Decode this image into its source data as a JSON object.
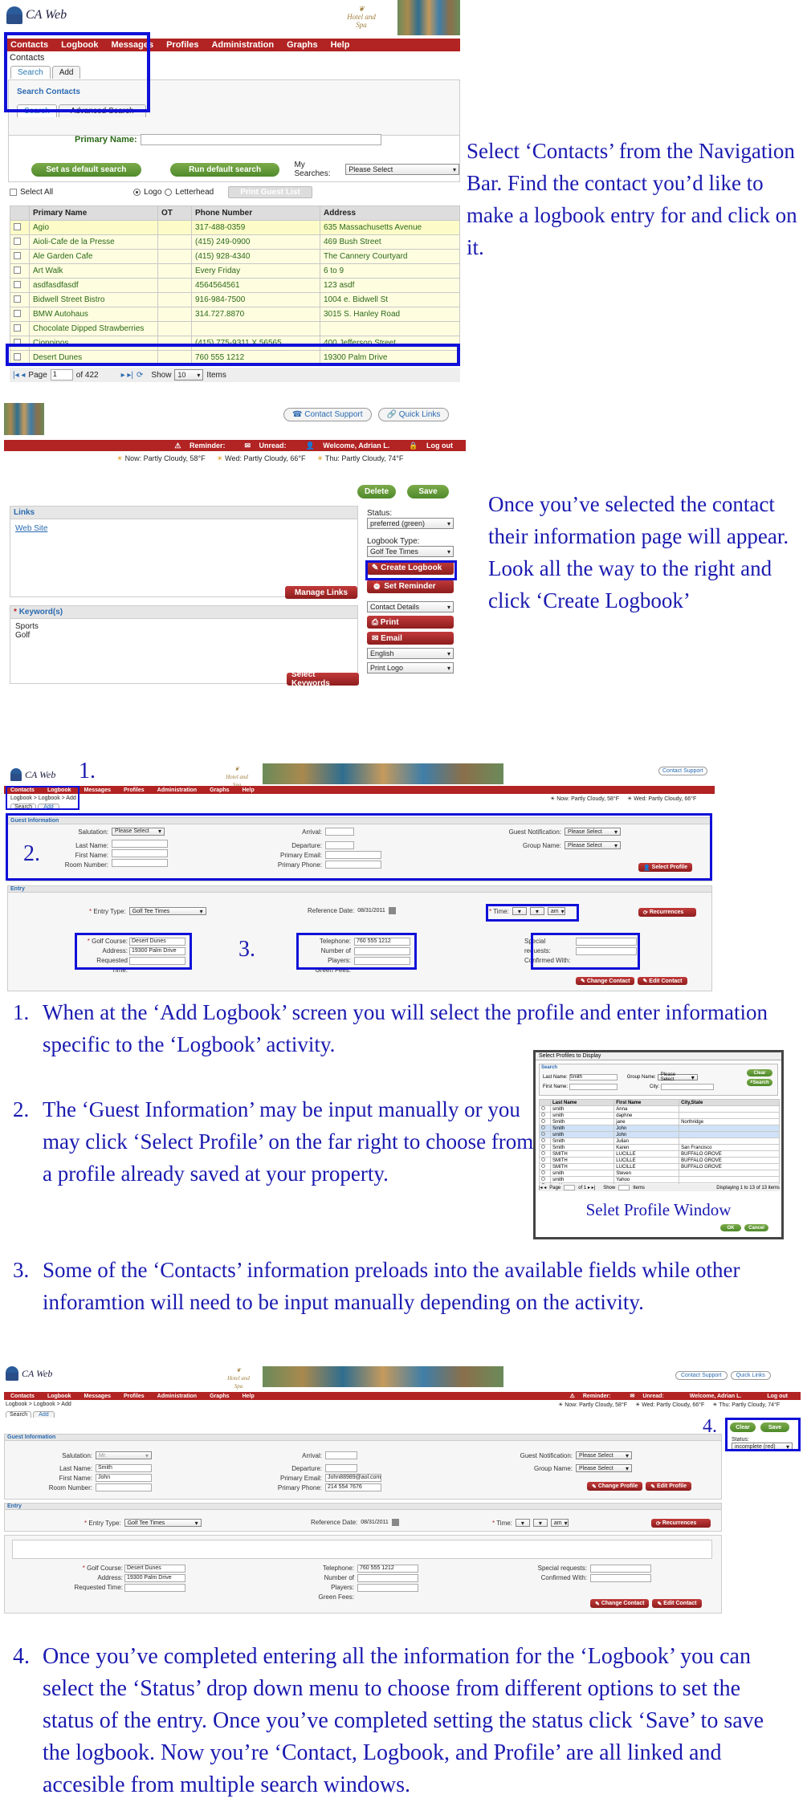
{
  "shot1": {
    "app_name": "CA Web",
    "hotel_logo_lines": [
      "Hotel and Spa"
    ],
    "nav": [
      "Contacts",
      "Logbook",
      "Messages",
      "Profiles",
      "Administration",
      "Graphs",
      "Help"
    ],
    "page_title": "Contacts",
    "tabs": [
      "Search",
      "Add"
    ],
    "section": "Search Contacts",
    "subtabs": [
      "Search",
      "Advanced Search"
    ],
    "primary_name_label": "Primary Name:",
    "set_default": "Set as default search",
    "run_default": "Run default search",
    "my_searches_label": "My Searches:",
    "my_searches_value": "Please Select",
    "select_all": "Select All",
    "logo_opt": "Logo",
    "letterhead_opt": "Letterhead",
    "print_guest_list": "Print Guest List",
    "columns": [
      "Primary Name",
      "OT",
      "Phone Number",
      "Address"
    ],
    "rows": [
      [
        "Agio",
        "",
        "317-488-0359",
        "635 Massachusetts Avenue"
      ],
      [
        "Aioli-Cafe de la Presse",
        "",
        "(415) 249-0900",
        "469 Bush Street"
      ],
      [
        "Ale Garden Cafe",
        "",
        "(415) 928-4340",
        "The Cannery Courtyard"
      ],
      [
        "Art Walk",
        "",
        "Every Friday",
        "6 to 9"
      ],
      [
        "asdfasdfasdf",
        "",
        "4564564561",
        "123 asdf"
      ],
      [
        "Bidwell Street Bistro",
        "",
        "916-984-7500",
        "1004 e. Bidwell St"
      ],
      [
        "BMW Autohaus",
        "",
        "314.727.8870",
        "3015 S. Hanley Road"
      ],
      [
        "Chocolate Dipped Strawberries",
        "",
        "",
        ""
      ],
      [
        "Cioppinos",
        "",
        "(415) 775-9311 X 56565",
        "400 Jefferson Street"
      ],
      [
        "Desert Dunes",
        "",
        "760 555 1212",
        "19300 Palm Drive"
      ]
    ],
    "pager_page": "Page",
    "pager_value": "1",
    "pager_of": "of 422",
    "pager_show": "Show",
    "pager_show_value": "10",
    "pager_items": "Items"
  },
  "instruction1": "Select ‘Contacts’ from the Navigation Bar.  Find the contact you’d like to make a logbook entry for and click on it.",
  "shot2": {
    "contact_support": "Contact Support",
    "quick_links": "Quick Links",
    "reminder": "Reminder:",
    "unread": "Unread:",
    "welcome": "Welcome, Adrian L.",
    "logout": "Log out",
    "weather_now": "Now: Partly Cloudy, 58°F",
    "weather_wed": "Wed: Partly Cloudy, 66°F",
    "weather_thu": "Thu: Partly Cloudy, 74°F",
    "delete": "Delete",
    "save": "Save",
    "links_hdr": "Links",
    "web_site": "Web Site",
    "manage_links": "Manage Links",
    "keywords_hdr": "Keyword(s)",
    "keywords": [
      "Sports",
      "Golf"
    ],
    "select_keywords": "Select Keywords",
    "status_label": "Status:",
    "status_value": "preferred (green)",
    "logbook_type_label": "Logbook Type:",
    "logbook_type_value": "Golf Tee Times",
    "create_logbook": "Create Logbook",
    "set_reminder": "Set Reminder",
    "contact_details": "Contact Details",
    "print": "Print",
    "email": "Email",
    "language": "English",
    "print_logo": "Print Logo"
  },
  "instruction2": "Once you’ve selected the contact their information page will appear.  Look all the way to the right and click ‘Create Logbook’",
  "shot3": {
    "marker1": "1.",
    "marker2": "2.",
    "marker3": "3.",
    "breadcrumb": "Logbook > Logbook > Add",
    "contact_support": "Contact Support",
    "guest_info_hdr": "Guest Information",
    "salutation": "Salutation:",
    "please_select": "Please Select",
    "last_name": "Last Name:",
    "first_name": "First Name:",
    "room_number": "Room Number:",
    "arrival": "Arrival:",
    "departure": "Departure:",
    "primary_email": "Primary Email:",
    "primary_phone": "Primary Phone:",
    "guest_notification": "Guest Notification:",
    "group_name": "Group Name:",
    "select_profile": "Select Profile",
    "entry_hdr": "Entry",
    "entry_type": "Entry Type:",
    "entry_type_value": "Golf Tee Times",
    "reference_date": "Reference Date:",
    "reference_date_value": "08/31/2011",
    "time": "Time:",
    "am": "am",
    "recurrences": "Recurrences",
    "golf_course": "Golf Course:",
    "golf_course_value": "Desert Dunes",
    "address": "Address:",
    "address_value": "19300 Palm Drive",
    "requested_time": "Requested Time:",
    "telephone": "Telephone:",
    "telephone_value": "760 555 1212",
    "num_players": "Number of Players:",
    "green_fees": "Green Fees:",
    "special_requests": "Special requests:",
    "confirmed_with": "Confirmed With:",
    "change_contact": "Change Contact",
    "edit_contact": "Edit Contact"
  },
  "steps": [
    {
      "num": "1.",
      "text": "When at the ‘Add Logbook’ screen you will select the profile and enter information specific to the ‘Logbook’ activity."
    },
    {
      "num": "2.",
      "text": "The ‘Guest Information’ may be input manually or you may click ‘Select Profile’ on the far right to choose from a profile already saved at your property."
    },
    {
      "num": "3.",
      "text": "Some of the ‘Contacts’ information preloads into the available fields while other inforamtion will need to be input manually depending on the activity."
    }
  ],
  "profile_window": {
    "title": "Select Profiles to Display",
    "search": "Search",
    "last_name": "Last Name:",
    "last_name_value": "Smith",
    "first_name": "First Name:",
    "group_name": "Group Name:",
    "city": "City:",
    "clear": "Clear",
    "search_btn": "Search",
    "columns": [
      "Last Name",
      "First Name",
      "City,State"
    ],
    "rows": [
      [
        "smith",
        "Anna",
        ""
      ],
      [
        "smith",
        "daphne",
        ""
      ],
      [
        "Smith",
        "jane",
        "Northridge"
      ],
      [
        "Smith",
        "John",
        ""
      ],
      [
        "smith",
        "John",
        ""
      ],
      [
        "Smith",
        "Julian",
        ""
      ],
      [
        "Smith",
        "Karen",
        "San Francisco"
      ],
      [
        "SMITH",
        "LUCILLE",
        "BUFFALO GROVE"
      ],
      [
        "SMITH",
        "LUCILLE",
        "BUFFALO GROVE"
      ],
      [
        "SMITH",
        "LUCILLE",
        "BUFFALO GROVE"
      ],
      [
        "smith",
        "Steven",
        ""
      ],
      [
        "smith",
        "Yahoo",
        ""
      ],
      [
        "smith",
        "yvette",
        ""
      ]
    ],
    "displaying": "Displaying 1 to 13 of 13 items",
    "ok": "OK",
    "cancel": "Cancel",
    "caption": "Selet Profile Window"
  },
  "shot4": {
    "marker4": "4.",
    "clear": "Clear",
    "save": "Save",
    "status_label": "Status:",
    "status_value": "incomplete (red)",
    "salutation_value": "Mr.",
    "last_name_value": "Smith",
    "first_name_value": "John",
    "email_value": "John88989@aol.com",
    "phone_value": "214 554 7676",
    "change_profile": "Change Profile",
    "edit_profile": "Edit Profile"
  },
  "instruction4": {
    "num": "4.",
    "text": "Once you’ve completed entering all the information for the ‘Logbook’ you can select the ‘Status’ drop down menu to choose from different options to set the status of the entry.  Once you’ve completed setting the status click ‘Save’ to save the logbook.  Now you’re ‘Contact, Logbook, and Profile’ are all linked and accesible from multiple search windows."
  }
}
